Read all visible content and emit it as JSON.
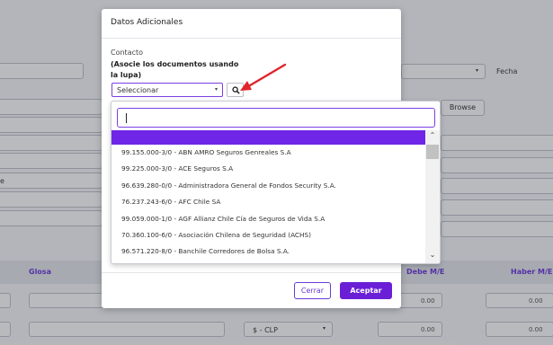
{
  "background": {
    "fecha_label": "Fecha",
    "browse_label": "Browse",
    "e_label": "e",
    "columns": {
      "glosa": "Glosa",
      "debe": "Debe M/E",
      "haber": "Haber M/E"
    },
    "amount_debe": "0.00",
    "amount_haber": "0.00",
    "amount_debe_2": "0.00",
    "amount_haber_2": "0.00",
    "currency": "$ - CLP"
  },
  "modal": {
    "title": "Datos Adicionales",
    "contact_label": "Contacto",
    "help_text": "(Asocie los documentos usando la lupa)",
    "select_value": "Seleccionar",
    "cancel_label": "Cerrar",
    "accept_label": "Aceptar"
  },
  "dropdown": {
    "search_value": "",
    "items": [
      "",
      "99.155.000-3/0 - ABN AMRO Seguros Genreales S.A",
      "99.225.000-3/0 - ACE Seguros S.A",
      "96.639.280-0/0 - Administradora General de Fondos Security S.A.",
      "76.237.243-6/0 - AFC Chile SA",
      "99.059.000-1/0 - AGF Allianz Chile Cía de Seguros de Vida S.A",
      "70.360.100-6/0 - Asociación Chilena de Seguridad (ACHS)",
      "96.571.220-8/0 - Banchile Corredores de Bolsa S.A."
    ]
  },
  "colors": {
    "accent": "#6a1fd6",
    "highlight": "#7026e6",
    "arrow": "#e0242b"
  }
}
